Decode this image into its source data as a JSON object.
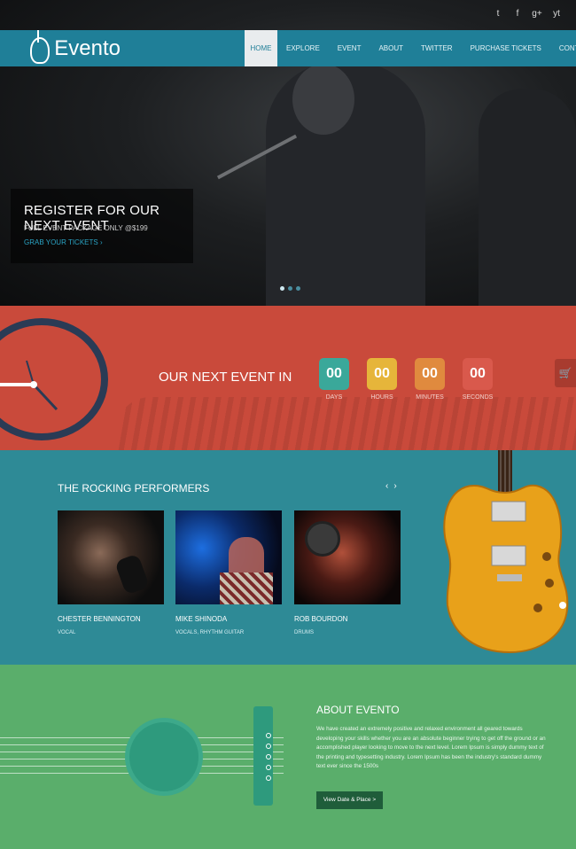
{
  "social": [
    "t",
    "f",
    "g+",
    "yt"
  ],
  "brand": {
    "name": "Evento"
  },
  "nav": [
    "HOME",
    "EXPLORE",
    "EVENT",
    "ABOUT",
    "TWITTER",
    "PURCHASE TICKETS",
    "CONTACT"
  ],
  "hero": {
    "headline": "REGISTER FOR OUR NEXT EVENT",
    "subline": "FULL EVENT PACKAGE ONLY @$199",
    "cta": "GRAB YOUR TICKETS  ›"
  },
  "countdown": {
    "title": "OUR NEXT EVENT IN",
    "units": [
      {
        "value": "00",
        "label": "DAYS",
        "color": "#3aa89a"
      },
      {
        "value": "00",
        "label": "HOURS",
        "color": "#e6b53a"
      },
      {
        "value": "00",
        "label": "MINUTES",
        "color": "#e08a3e"
      },
      {
        "value": "00",
        "label": "SECONDS",
        "color": "#d9594c"
      }
    ]
  },
  "performers": {
    "title": "THE ROCKING PERFORMERS",
    "prev": "‹",
    "next": "›",
    "list": [
      {
        "name": "CHESTER BENNINGTON",
        "role": "VOCAL"
      },
      {
        "name": "MIKE SHINODA",
        "role": "VOCALS, RHYTHM GUITAR"
      },
      {
        "name": "ROB BOURDON",
        "role": "DRUMS"
      }
    ]
  },
  "about": {
    "title": "ABOUT EVENTO",
    "text": "We have created an extremely positive and relaxed environment all geared towards developing your skills whether you are an absolute beginner trying to get off the ground or an accomplished player looking to move to the next level. Lorem Ipsum is simply dummy text of the printing and typesetting industry. Lorem Ipsum has been the industry's standard dummy text ever since the 1500s",
    "button": "View Date & Place >"
  },
  "colors": {
    "topbar": "#1f7f98",
    "countdown_bg": "#c94a3b",
    "performers_bg": "#2e8a96",
    "about_bg": "#5aae6b"
  }
}
